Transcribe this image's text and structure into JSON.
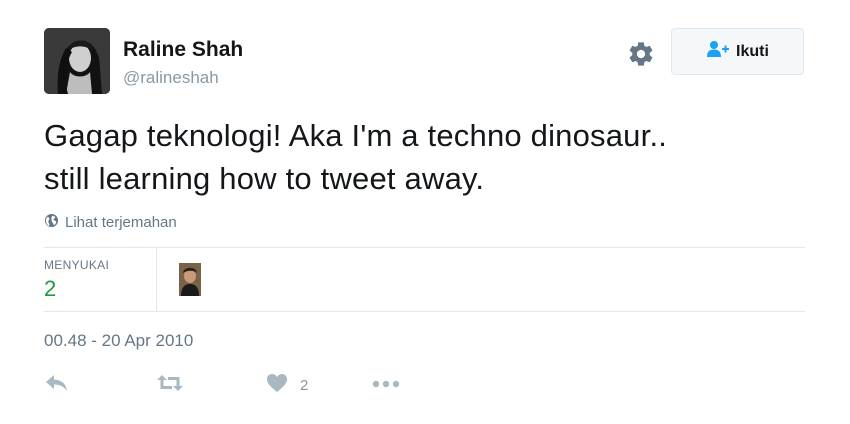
{
  "author": {
    "display_name": "Raline Shah",
    "screen_name": "@ralineshah"
  },
  "header": {
    "settings_icon": "gear-icon",
    "follow_icon": "follow-user-icon",
    "follow_label": "Ikuti"
  },
  "tweet": {
    "text_line_1": "Gagap teknologi! Aka I'm a techno dinosaur..",
    "text_line_2": "still learning how to tweet away.",
    "translate_icon": "globe-icon",
    "translate_label": "Lihat terjemahan"
  },
  "stats": {
    "likes_label": "MENYUKAI",
    "likes_value": "2"
  },
  "timestamp": "00.48 - 20 Apr 2010",
  "actions": {
    "reply_icon": "reply-icon",
    "retweet_icon": "retweet-icon",
    "like_icon": "heart-icon",
    "like_count": "2",
    "more_icon": "more-icon"
  },
  "colors": {
    "text_primary": "#14171a",
    "text_secondary": "#657786",
    "icon_gray": "#aab8c2",
    "likes_count_green": "#1c9b3e",
    "follow_blue": "#1da1f2",
    "divider": "#e1e8ed"
  }
}
